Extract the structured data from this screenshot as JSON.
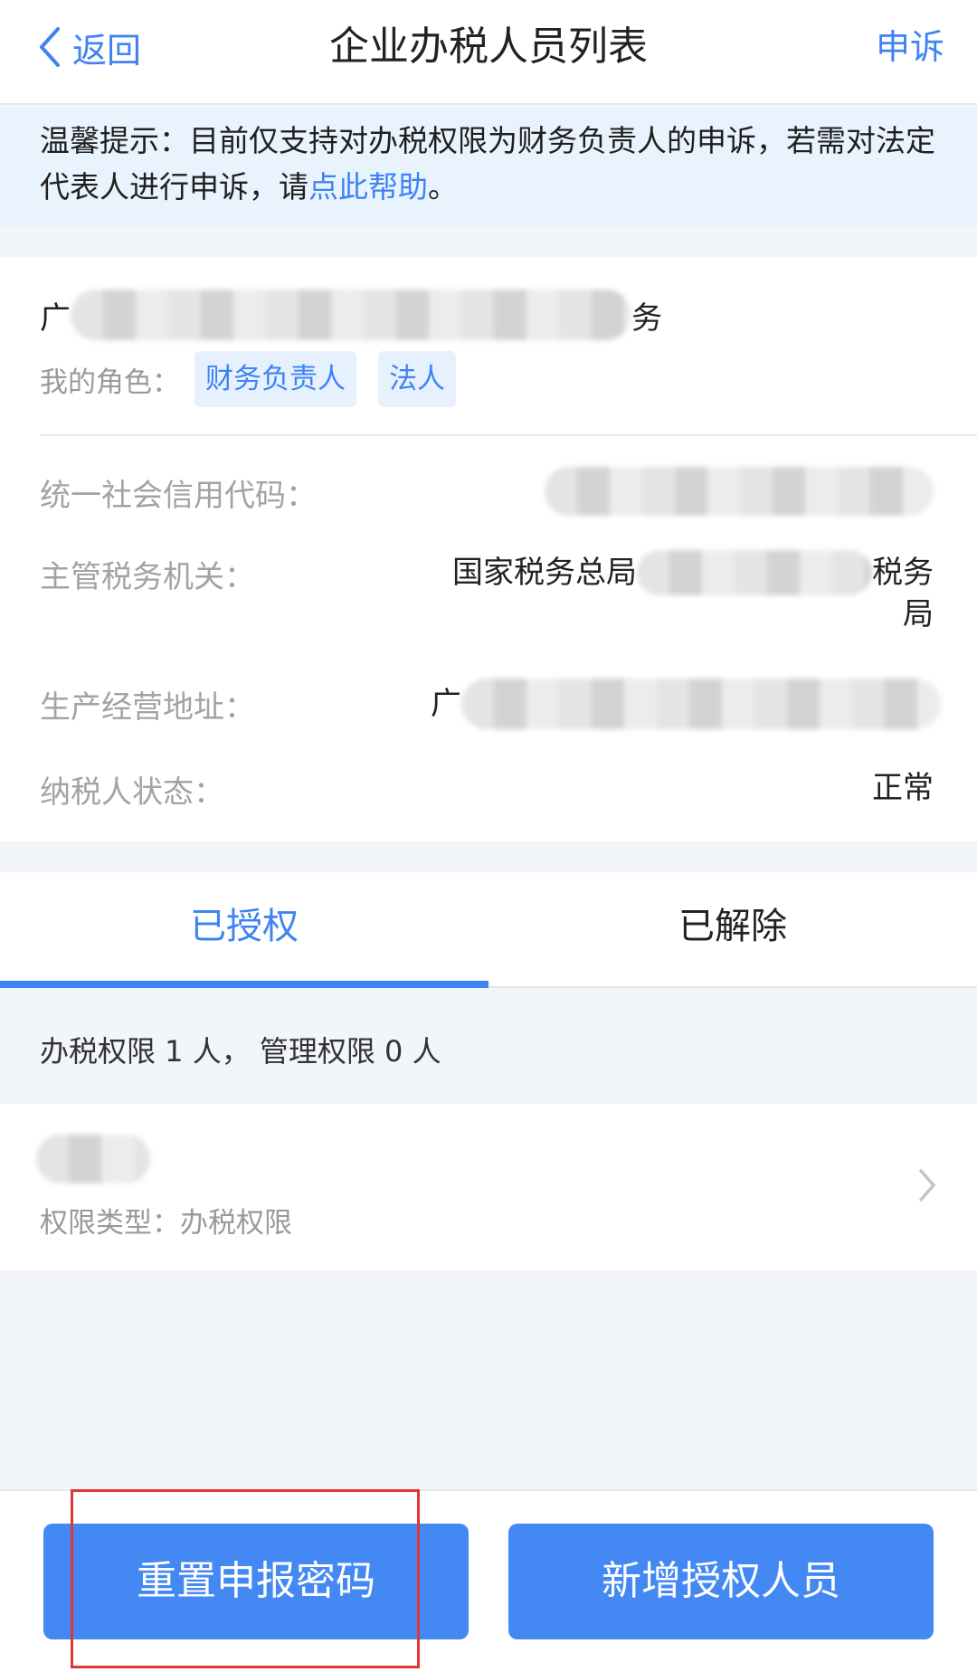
{
  "nav": {
    "back_label": "返回",
    "title": "企业办税人员列表",
    "appeal_label": "申诉"
  },
  "tip": {
    "text_before_link": "温馨提示：目前仅支持对办税权限为财务负责人的申诉，若需对法定代表人进行申诉，请",
    "link_text": "点此帮助",
    "text_after_link": "。"
  },
  "company": {
    "name_prefix": "广",
    "name_suffix": "务",
    "role_label": "我的角色：",
    "roles": [
      "财务负责人",
      "法人"
    ]
  },
  "info": {
    "credit_code_label": "统一社会信用代码：",
    "tax_authority_label": "主管税务机关：",
    "tax_authority_prefix": "国家税务总局",
    "tax_authority_suffix": "税务",
    "tax_authority_last": "局",
    "address_label": "生产经营地址：",
    "address_prefix": "广",
    "status_label": "纳税人状态：",
    "status_value": "正常"
  },
  "tabs": {
    "authorized": "已授权",
    "removed": "已解除",
    "active_index": 0
  },
  "summary": {
    "text": "办税权限 1 人， 管理权限 0 人"
  },
  "person": {
    "type_label": "权限类型：办税权限"
  },
  "buttons": {
    "reset_password": "重置申报密码",
    "add_authorized": "新增授权人员"
  },
  "colors": {
    "accent": "#3f83f3",
    "button": "#4488f4",
    "tip_background": "#e9f3fd",
    "highlight": "#e03636"
  },
  "icons": {
    "back": "chevron-left-icon",
    "row_arrow": "chevron-right-icon"
  }
}
